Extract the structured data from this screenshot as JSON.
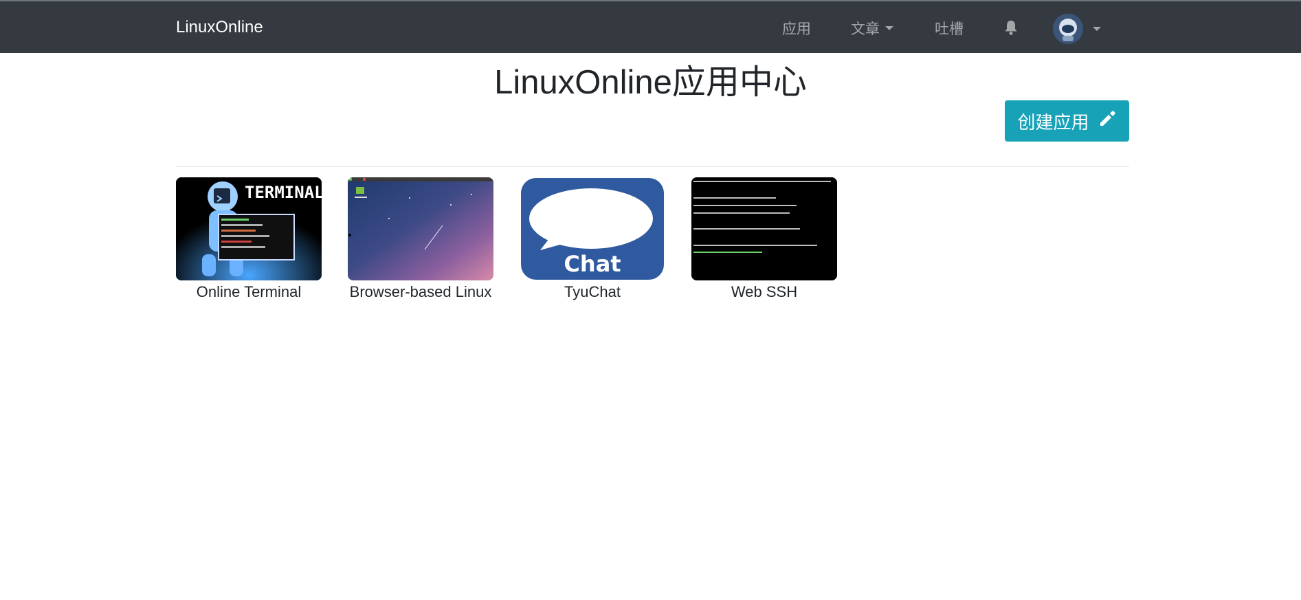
{
  "navbar": {
    "brand": "LinuxOnline",
    "items": [
      {
        "label": "应用"
      },
      {
        "label": "文章"
      },
      {
        "label": "吐槽"
      }
    ]
  },
  "page": {
    "title": "LinuxOnline应用中心",
    "create_button": "创建应用"
  },
  "apps": [
    {
      "name": "Online Terminal",
      "thumb_text": "TERMINAL"
    },
    {
      "name": "Browser-based Linux"
    },
    {
      "name": "TyuChat",
      "thumb_text": "Chat"
    },
    {
      "name": "Web SSH"
    }
  ],
  "colors": {
    "navbar_bg": "#343a40",
    "accent": "#17a2b8",
    "chat_blue": "#2f5aa0"
  },
  "icons": {
    "bell": "bell-icon",
    "create": "pencil-icon",
    "dropdown": "caret-down-icon"
  }
}
